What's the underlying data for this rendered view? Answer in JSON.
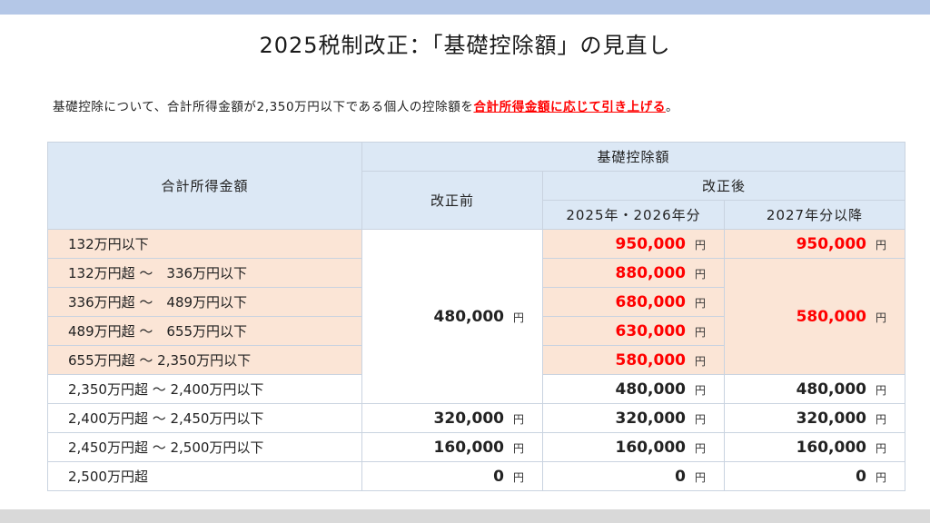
{
  "title": "2025税制改正：「基礎控除額」の見直し",
  "intro": {
    "prefix": "基礎控除について、合計所得金額が2,350万円以下である個人の控除額を",
    "highlight": "合計所得金額に応じて引き上げる",
    "suffix": "。"
  },
  "table": {
    "header_income": "合計所得金額",
    "header_deduction": "基礎控除額",
    "header_before": "改正前",
    "header_after": "改正後",
    "header_2025": "2025年・2026年分",
    "header_2027": "2027年分以降",
    "yen": "円",
    "rows": [
      {
        "range": "132万円以下",
        "after_2025": "950,000",
        "after_2027": "950,000"
      },
      {
        "range": "132万円超 ～　336万円以下",
        "after_2025": "880,000"
      },
      {
        "range": "336万円超 ～　489万円以下",
        "after_2025": "680,000"
      },
      {
        "range": "489万円超 ～　655万円以下",
        "after_2025": "630,000"
      },
      {
        "range": "655万円超 ～ 2,350万円以下",
        "after_2025": "580,000"
      },
      {
        "range": "2,350万円超 ～ 2,400万円以下",
        "after_2025": "480,000",
        "after_2027": "480,000"
      },
      {
        "range": "2,400万円超 ～ 2,450万円以下",
        "before": "320,000",
        "after_2025": "320,000",
        "after_2027": "320,000"
      },
      {
        "range": "2,450万円超 ～ 2,500万円以下",
        "before": "160,000",
        "after_2025": "160,000",
        "after_2027": "160,000"
      },
      {
        "range": "2,500万円超",
        "before": "0",
        "after_2025": "0",
        "after_2027": "0"
      }
    ],
    "merged_before": "480,000",
    "merged_2027": "580,000"
  },
  "colors": {
    "top_bar": "#b4c7e7",
    "bottom_bar": "#d9d9d9",
    "header_bg": "#dce8f5",
    "highlight_bg": "#fbe5d6",
    "accent_red": "#ff0000"
  }
}
